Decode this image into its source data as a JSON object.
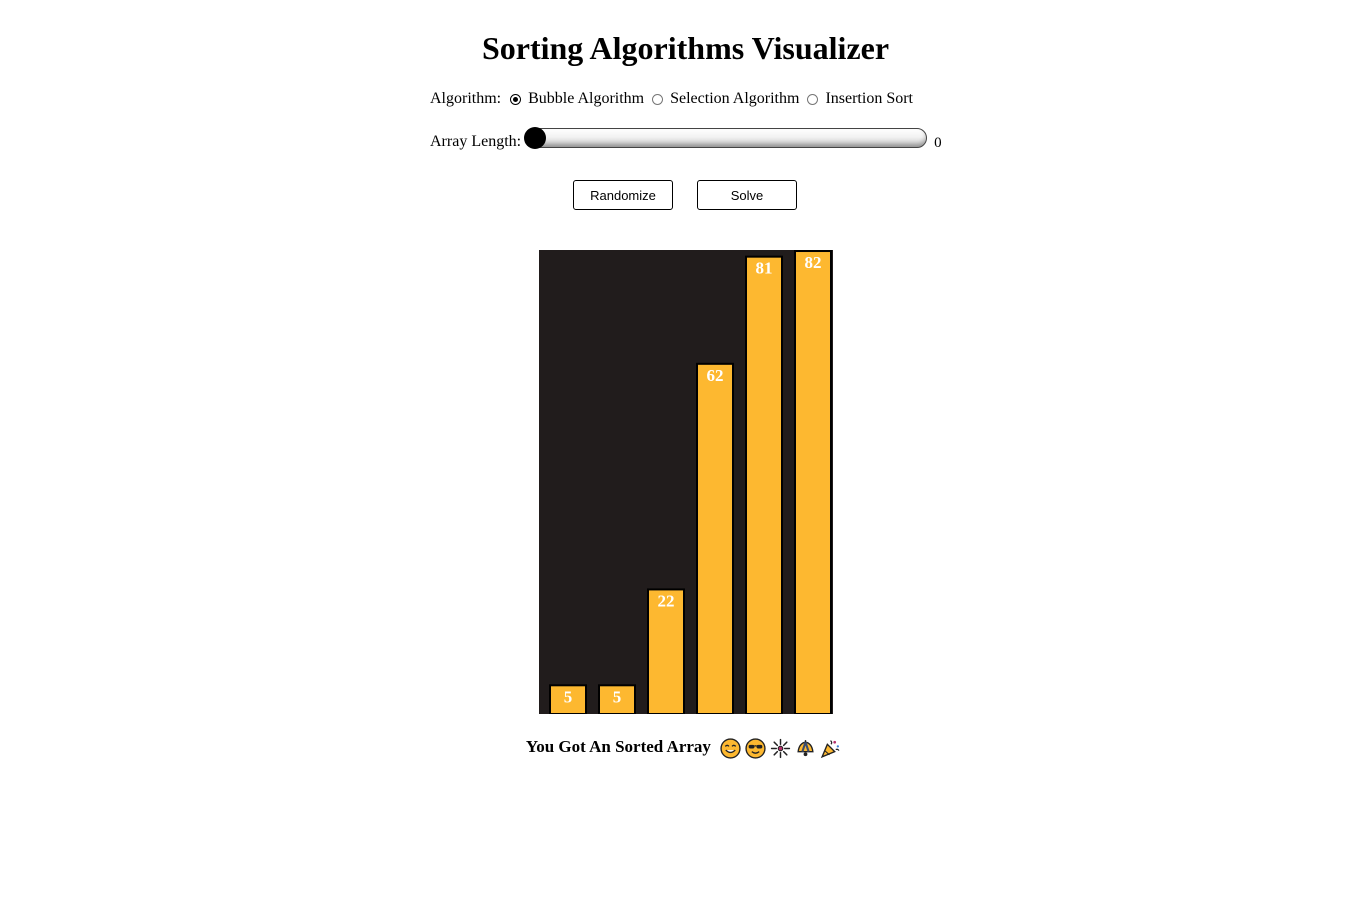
{
  "title": "Sorting Algorithms Visualizer",
  "algorithm": {
    "label": "Algorithm:",
    "options": [
      {
        "label": "Bubble Algorithm",
        "checked": true
      },
      {
        "label": "Selection Algorithm",
        "checked": false
      },
      {
        "label": "Insertion Sort",
        "checked": false
      }
    ]
  },
  "array_length": {
    "label": "Array Length:",
    "value": "0",
    "slider_fraction": 0
  },
  "buttons": {
    "randomize": "Randomize",
    "solve": "Solve"
  },
  "chart_data": {
    "type": "bar",
    "values": [
      5,
      5,
      22,
      62,
      81,
      82
    ],
    "bar_color": "#fdb830",
    "background_color": "#211c1c",
    "label_color": "#ffffff"
  },
  "result": {
    "message": "You Got An Sorted Array",
    "icons": [
      "smiling-face-icon",
      "sunglasses-face-icon",
      "fireworks-icon",
      "bell-icon",
      "party-popper-icon"
    ]
  }
}
